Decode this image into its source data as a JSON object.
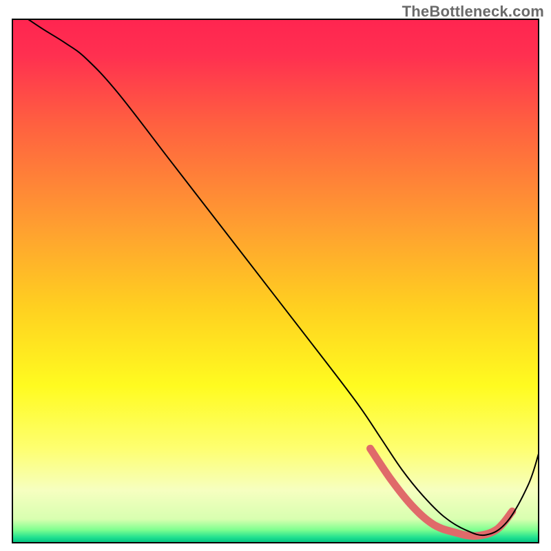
{
  "watermark": "TheBottleneck.com",
  "chart_data": {
    "type": "line",
    "title": "",
    "xlabel": "",
    "ylabel": "",
    "xlim": [
      0,
      100
    ],
    "ylim": [
      0,
      100
    ],
    "axes_visible": false,
    "grid": false,
    "background": {
      "type": "vertical-gradient",
      "stops": [
        {
          "offset": 0.0,
          "color": "#ff2550"
        },
        {
          "offset": 0.07,
          "color": "#ff3050"
        },
        {
          "offset": 0.2,
          "color": "#ff6040"
        },
        {
          "offset": 0.4,
          "color": "#ffa030"
        },
        {
          "offset": 0.55,
          "color": "#ffd020"
        },
        {
          "offset": 0.7,
          "color": "#fffb20"
        },
        {
          "offset": 0.82,
          "color": "#feff70"
        },
        {
          "offset": 0.9,
          "color": "#f6ffc0"
        },
        {
          "offset": 0.955,
          "color": "#d8ffb0"
        },
        {
          "offset": 0.975,
          "color": "#80ff90"
        },
        {
          "offset": 0.99,
          "color": "#20e090"
        },
        {
          "offset": 1.0,
          "color": "#00c080"
        }
      ]
    },
    "series": [
      {
        "name": "bottleneck-curve",
        "color": "#000000",
        "stroke_width": 2,
        "x": [
          3,
          6,
          10,
          14,
          20,
          30,
          40,
          50,
          60,
          66,
          70,
          74,
          78,
          82,
          86,
          90,
          94,
          98,
          100
        ],
        "y": [
          100,
          98,
          95.5,
          92.5,
          86,
          73,
          60,
          47,
          34,
          26,
          20,
          14,
          9,
          5,
          2.5,
          1.5,
          4,
          11,
          17
        ]
      }
    ],
    "highlight": {
      "color": "#e06a6a",
      "stroke_width": 11,
      "x": [
        68,
        72,
        76,
        80,
        84,
        88,
        92,
        95
      ],
      "y": [
        18,
        12,
        7,
        3.5,
        2,
        1.3,
        2.5,
        6
      ]
    }
  }
}
